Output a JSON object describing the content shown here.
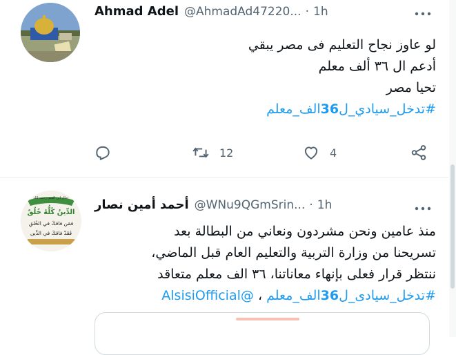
{
  "tweets": [
    {
      "author_name": "Ahmad Adel",
      "handle": "@AhmadAd47220...",
      "separator": "·",
      "time": "1h",
      "lines": [
        {
          "text": "لو عاوز نجاح التعليم فى مصر يبقي"
        },
        {
          "text": "أدعم ال ٣٦ ألف معلم"
        },
        {
          "text": "تحيا مصر"
        }
      ],
      "hashtag": {
        "prefix": "#تدخل_سيادي_ل",
        "number": "36",
        "suffix": "الف_معلم"
      },
      "actions": {
        "reply_count": "",
        "retweet_count": "12",
        "like_count": "4"
      },
      "avatar": {
        "description_icon": "dome-of-the-rock-photo"
      }
    },
    {
      "author_name": "أحمد أمين نصار",
      "handle": "@WNu9QGmSrin...",
      "separator": "·",
      "time": "1h",
      "lines": [
        {
          "text": "منذ عامين ونحن مشردون ونعاني من البطالة بعد"
        },
        {
          "text": "تسريحنا من وزارة التربية والتعليم العام قبل الماضي،"
        },
        {
          "text": "ننتظر قرار فعلى بإنهاء معاناتنا، ٣٦ الف معلم متعاقد"
        }
      ],
      "hashtag": {
        "prefix": "#تدخل_سيادى_ل",
        "number": "36",
        "suffix": "الف_معلم"
      },
      "comma": "،",
      "mention": "@AlsisiOfficial",
      "avatar": {
        "lines": [
          "حال ابن القيم رحمه الله:",
          "الدِّينُ كُلُّهُ خُلُقٌ",
          "فمَن فاقكَ في الخُلقِ",
          "فَقَدْ فاقكَ في الدِّين"
        ]
      }
    }
  ],
  "colors": {
    "accent": "#1d9bf0",
    "text": "#0f1419",
    "secondary": "#536471",
    "border": "#e6ecf0"
  }
}
